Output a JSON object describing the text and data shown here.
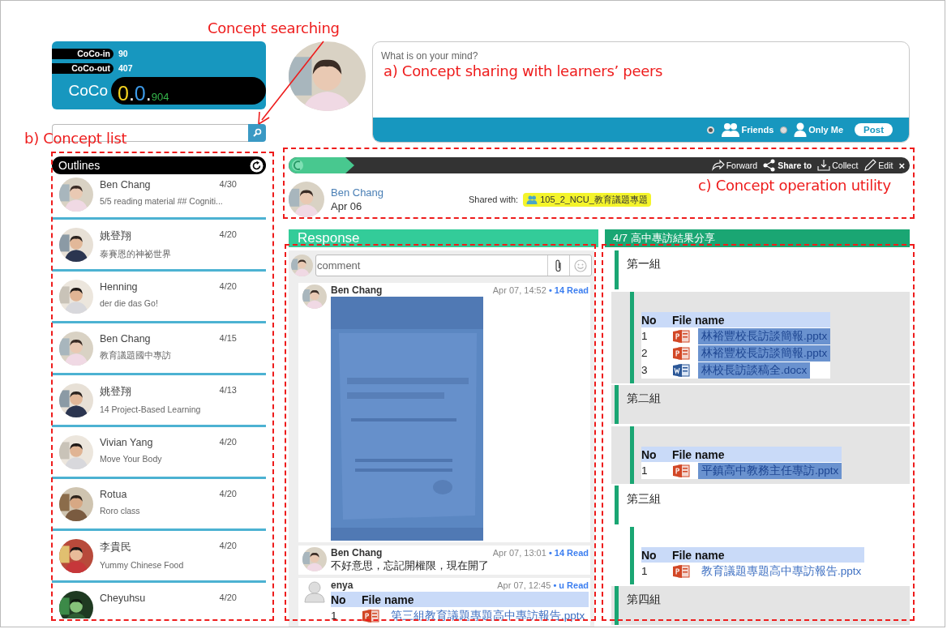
{
  "annotations": [
    {
      "text": "Concept searching",
      "kind": "search"
    },
    {
      "text": "a) Concept sharing with learners’ peers",
      "kind": "sharing"
    },
    {
      "text": "b) Concept list",
      "kind": "list"
    },
    {
      "text": "c) Concept operation utility",
      "kind": "utility"
    }
  ],
  "coco": {
    "stats": [
      {
        "label": "CoCo-in",
        "value": "90"
      },
      {
        "label": "CoCo-out",
        "value": "407"
      }
    ],
    "title": "CoCo",
    "score": [
      {
        "text": "0",
        "color": "#f4d320"
      },
      {
        "text": "."
      },
      {
        "text": "0",
        "color": "#3d9be9"
      },
      {
        "text": "."
      },
      {
        "text": "904",
        "color": "#34b44a"
      }
    ]
  },
  "outlines": {
    "title": "Outlines",
    "items": [
      {
        "name": "Ben Chang",
        "subtitle": "5/5 reading material ## Cogniti...",
        "date": "4/30"
      },
      {
        "name": "姚登翔",
        "subtitle": "泰賽恩的神祕世界",
        "date": "4/20"
      },
      {
        "name": "Henning",
        "subtitle": "der die das Go!",
        "date": "4/20"
      },
      {
        "name": "Ben Chang",
        "subtitle": "教育議題國中專訪",
        "date": "4/15"
      },
      {
        "name": "姚登翔",
        "subtitle": "14 Project-Based Learning",
        "date": "4/13"
      },
      {
        "name": "Vivian Yang",
        "subtitle": "Move Your Body",
        "date": "4/20"
      },
      {
        "name": "Rotua",
        "subtitle": "Roro class",
        "date": "4/20"
      },
      {
        "name": "李貴民",
        "subtitle": "Yummy Chinese Food",
        "date": "4/20"
      },
      {
        "name": "Cheyuhsu",
        "date": "4/20"
      }
    ]
  },
  "composer": {
    "placeholder": "What is on your mind?",
    "audience": [
      {
        "label": "Friends",
        "kind": "group",
        "selected": true
      },
      {
        "label": "Only Me",
        "kind": "person",
        "selected": false
      }
    ],
    "post_button": "Post"
  },
  "toolbar": {
    "actions": [
      {
        "label": "Forward",
        "kind": "forward"
      },
      {
        "label": "Share to",
        "kind": "share"
      },
      {
        "label": "Collect",
        "kind": "collect"
      },
      {
        "label": "Edit",
        "kind": "edit"
      }
    ],
    "close": "×"
  },
  "post": {
    "author": "Ben Chang",
    "date": "Apr 06",
    "shared_label": "Shared with:",
    "group": "105_2_NCU_教育議題專題"
  },
  "response": {
    "title": "Response",
    "comment_placeholder": "comment",
    "comments": [
      {
        "author": "Ben Chang",
        "photo": true,
        "time": "Apr 07, 14:52",
        "reads": "• 14 Read"
      },
      {
        "kind": "text",
        "author": "Ben Chang",
        "photo": true,
        "time": "Apr 07, 13:01",
        "reads": "• 14 Read",
        "text": "不好意思，忘記開權限，現在開了"
      },
      {
        "kind": "files",
        "author": "enya",
        "photo": false,
        "time": "Apr 07, 12:45",
        "reads": "• u Read",
        "columns": [
          "No",
          "File name"
        ],
        "rows": [
          {
            "no": "1",
            "kind": "pptx",
            "name": "第三組教育議題專題高中專訪報告.pptx",
            "highlighted": false
          }
        ]
      }
    ]
  },
  "outline_view": {
    "title": "4/7 高中專訪結果分享",
    "groups": [
      {
        "title": "第一組",
        "title_shaded": false,
        "files_shaded": true,
        "columns": [
          "No",
          "File name"
        ],
        "rows": [
          {
            "no": "1",
            "kind": "pptx",
            "name": "林裕豐校長訪談簡報.pptx",
            "highlighted": true
          },
          {
            "no": "2",
            "kind": "pptx",
            "name": "林裕豐校長訪談簡報.pptx",
            "highlighted": true
          },
          {
            "no": "3",
            "kind": "docx",
            "name": "林校長訪談稿全.docx",
            "highlighted": true
          }
        ]
      },
      {
        "title": "第二組",
        "title_shaded": true,
        "files_shaded": true,
        "columns": [
          "No",
          "File name"
        ],
        "rows": [
          {
            "no": "1",
            "kind": "pptx",
            "name": "平鎮高中教務主任專訪.pptx",
            "highlighted": true
          }
        ]
      },
      {
        "title": "第三組",
        "title_shaded": false,
        "files_shaded": false,
        "columns": [
          "No",
          "File name"
        ],
        "rows": [
          {
            "no": "1",
            "kind": "pptx",
            "name": "教育議題專題高中專訪報告.pptx",
            "highlighted": false
          }
        ]
      },
      {
        "title": "第四組",
        "title_shaded": true
      }
    ]
  }
}
